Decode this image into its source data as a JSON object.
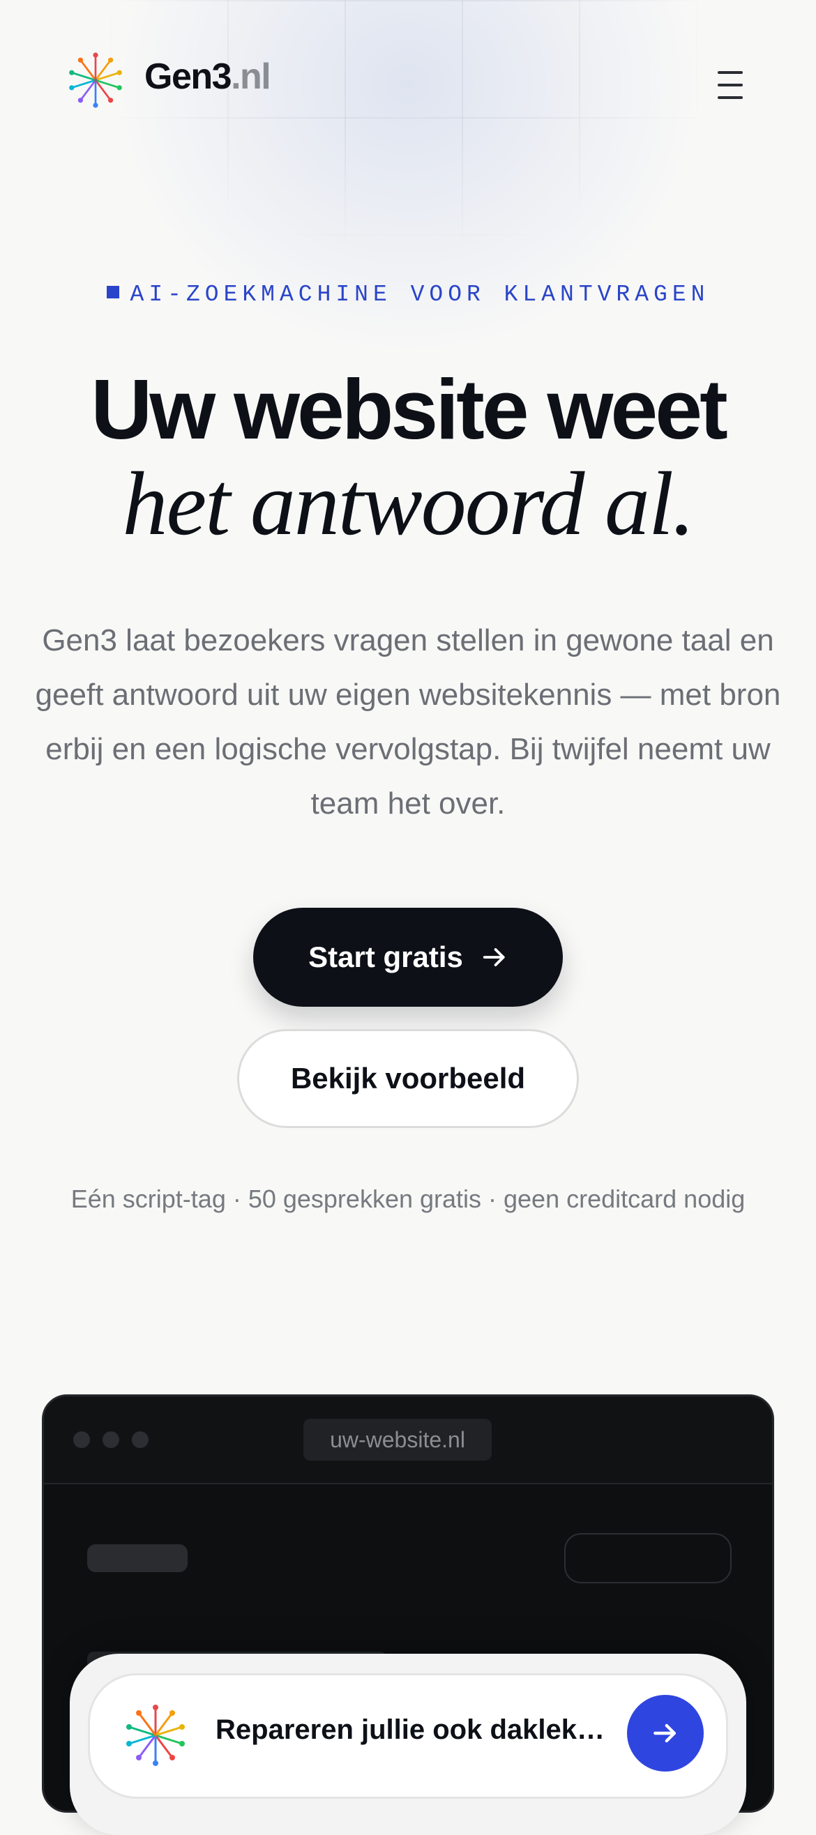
{
  "header": {
    "brand_name": "Gen3",
    "brand_tld": ".nl",
    "menu_icon": "hamburger-menu-icon"
  },
  "hero": {
    "eyebrow": "AI-ZOEKMACHINE VOOR KLANTVRAGEN",
    "title_line1": "Uw website weet",
    "title_line2": "het antwoord al.",
    "lead": "Gen3 laat bezoekers vragen stellen in gewone taal en geeft antwoord uit uw eigen websitekennis — met bron erbij en een logische vervolgstap. Bij twijfel neemt uw team het over.",
    "primary_cta": "Start gratis",
    "secondary_cta": "Bekijk voorbeeld",
    "fineprint": "Eén script-tag · 50 gesprekken gratis · geen creditcard nodig"
  },
  "demo": {
    "url": "uw-website.nl",
    "chat_query": "Repareren jullie ook daklekk..."
  },
  "colors": {
    "accent": "#2a45c9",
    "send_button": "#2f45e0",
    "dark": "#0d1117"
  }
}
